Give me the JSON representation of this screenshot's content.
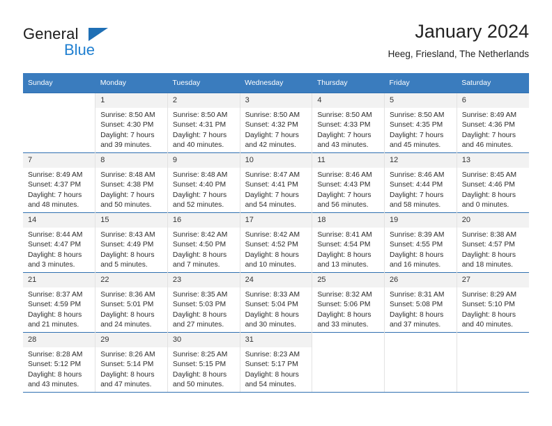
{
  "brand": {
    "name_top": "General",
    "name_bottom": "Blue",
    "accent_color": "#1f7fd0",
    "triangle_color": "#1f6fb5"
  },
  "header": {
    "title": "January 2024",
    "subtitle": "Heeg, Friesland, The Netherlands",
    "header_bg_color": "#3a7cbe",
    "row_divider_color": "#2f6fb0"
  },
  "weekday_headers": [
    "Sunday",
    "Monday",
    "Tuesday",
    "Wednesday",
    "Thursday",
    "Friday",
    "Saturday"
  ],
  "weeks": [
    [
      {
        "day": "",
        "sunrise": "",
        "sunset": "",
        "daylight_1": "",
        "daylight_2": ""
      },
      {
        "day": "1",
        "sunrise": "Sunrise: 8:50 AM",
        "sunset": "Sunset: 4:30 PM",
        "daylight_1": "Daylight: 7 hours",
        "daylight_2": "and 39 minutes."
      },
      {
        "day": "2",
        "sunrise": "Sunrise: 8:50 AM",
        "sunset": "Sunset: 4:31 PM",
        "daylight_1": "Daylight: 7 hours",
        "daylight_2": "and 40 minutes."
      },
      {
        "day": "3",
        "sunrise": "Sunrise: 8:50 AM",
        "sunset": "Sunset: 4:32 PM",
        "daylight_1": "Daylight: 7 hours",
        "daylight_2": "and 42 minutes."
      },
      {
        "day": "4",
        "sunrise": "Sunrise: 8:50 AM",
        "sunset": "Sunset: 4:33 PM",
        "daylight_1": "Daylight: 7 hours",
        "daylight_2": "and 43 minutes."
      },
      {
        "day": "5",
        "sunrise": "Sunrise: 8:50 AM",
        "sunset": "Sunset: 4:35 PM",
        "daylight_1": "Daylight: 7 hours",
        "daylight_2": "and 45 minutes."
      },
      {
        "day": "6",
        "sunrise": "Sunrise: 8:49 AM",
        "sunset": "Sunset: 4:36 PM",
        "daylight_1": "Daylight: 7 hours",
        "daylight_2": "and 46 minutes."
      }
    ],
    [
      {
        "day": "7",
        "sunrise": "Sunrise: 8:49 AM",
        "sunset": "Sunset: 4:37 PM",
        "daylight_1": "Daylight: 7 hours",
        "daylight_2": "and 48 minutes."
      },
      {
        "day": "8",
        "sunrise": "Sunrise: 8:48 AM",
        "sunset": "Sunset: 4:38 PM",
        "daylight_1": "Daylight: 7 hours",
        "daylight_2": "and 50 minutes."
      },
      {
        "day": "9",
        "sunrise": "Sunrise: 8:48 AM",
        "sunset": "Sunset: 4:40 PM",
        "daylight_1": "Daylight: 7 hours",
        "daylight_2": "and 52 minutes."
      },
      {
        "day": "10",
        "sunrise": "Sunrise: 8:47 AM",
        "sunset": "Sunset: 4:41 PM",
        "daylight_1": "Daylight: 7 hours",
        "daylight_2": "and 54 minutes."
      },
      {
        "day": "11",
        "sunrise": "Sunrise: 8:46 AM",
        "sunset": "Sunset: 4:43 PM",
        "daylight_1": "Daylight: 7 hours",
        "daylight_2": "and 56 minutes."
      },
      {
        "day": "12",
        "sunrise": "Sunrise: 8:46 AM",
        "sunset": "Sunset: 4:44 PM",
        "daylight_1": "Daylight: 7 hours",
        "daylight_2": "and 58 minutes."
      },
      {
        "day": "13",
        "sunrise": "Sunrise: 8:45 AM",
        "sunset": "Sunset: 4:46 PM",
        "daylight_1": "Daylight: 8 hours",
        "daylight_2": "and 0 minutes."
      }
    ],
    [
      {
        "day": "14",
        "sunrise": "Sunrise: 8:44 AM",
        "sunset": "Sunset: 4:47 PM",
        "daylight_1": "Daylight: 8 hours",
        "daylight_2": "and 3 minutes."
      },
      {
        "day": "15",
        "sunrise": "Sunrise: 8:43 AM",
        "sunset": "Sunset: 4:49 PM",
        "daylight_1": "Daylight: 8 hours",
        "daylight_2": "and 5 minutes."
      },
      {
        "day": "16",
        "sunrise": "Sunrise: 8:42 AM",
        "sunset": "Sunset: 4:50 PM",
        "daylight_1": "Daylight: 8 hours",
        "daylight_2": "and 7 minutes."
      },
      {
        "day": "17",
        "sunrise": "Sunrise: 8:42 AM",
        "sunset": "Sunset: 4:52 PM",
        "daylight_1": "Daylight: 8 hours",
        "daylight_2": "and 10 minutes."
      },
      {
        "day": "18",
        "sunrise": "Sunrise: 8:41 AM",
        "sunset": "Sunset: 4:54 PM",
        "daylight_1": "Daylight: 8 hours",
        "daylight_2": "and 13 minutes."
      },
      {
        "day": "19",
        "sunrise": "Sunrise: 8:39 AM",
        "sunset": "Sunset: 4:55 PM",
        "daylight_1": "Daylight: 8 hours",
        "daylight_2": "and 16 minutes."
      },
      {
        "day": "20",
        "sunrise": "Sunrise: 8:38 AM",
        "sunset": "Sunset: 4:57 PM",
        "daylight_1": "Daylight: 8 hours",
        "daylight_2": "and 18 minutes."
      }
    ],
    [
      {
        "day": "21",
        "sunrise": "Sunrise: 8:37 AM",
        "sunset": "Sunset: 4:59 PM",
        "daylight_1": "Daylight: 8 hours",
        "daylight_2": "and 21 minutes."
      },
      {
        "day": "22",
        "sunrise": "Sunrise: 8:36 AM",
        "sunset": "Sunset: 5:01 PM",
        "daylight_1": "Daylight: 8 hours",
        "daylight_2": "and 24 minutes."
      },
      {
        "day": "23",
        "sunrise": "Sunrise: 8:35 AM",
        "sunset": "Sunset: 5:03 PM",
        "daylight_1": "Daylight: 8 hours",
        "daylight_2": "and 27 minutes."
      },
      {
        "day": "24",
        "sunrise": "Sunrise: 8:33 AM",
        "sunset": "Sunset: 5:04 PM",
        "daylight_1": "Daylight: 8 hours",
        "daylight_2": "and 30 minutes."
      },
      {
        "day": "25",
        "sunrise": "Sunrise: 8:32 AM",
        "sunset": "Sunset: 5:06 PM",
        "daylight_1": "Daylight: 8 hours",
        "daylight_2": "and 33 minutes."
      },
      {
        "day": "26",
        "sunrise": "Sunrise: 8:31 AM",
        "sunset": "Sunset: 5:08 PM",
        "daylight_1": "Daylight: 8 hours",
        "daylight_2": "and 37 minutes."
      },
      {
        "day": "27",
        "sunrise": "Sunrise: 8:29 AM",
        "sunset": "Sunset: 5:10 PM",
        "daylight_1": "Daylight: 8 hours",
        "daylight_2": "and 40 minutes."
      }
    ],
    [
      {
        "day": "28",
        "sunrise": "Sunrise: 8:28 AM",
        "sunset": "Sunset: 5:12 PM",
        "daylight_1": "Daylight: 8 hours",
        "daylight_2": "and 43 minutes."
      },
      {
        "day": "29",
        "sunrise": "Sunrise: 8:26 AM",
        "sunset": "Sunset: 5:14 PM",
        "daylight_1": "Daylight: 8 hours",
        "daylight_2": "and 47 minutes."
      },
      {
        "day": "30",
        "sunrise": "Sunrise: 8:25 AM",
        "sunset": "Sunset: 5:15 PM",
        "daylight_1": "Daylight: 8 hours",
        "daylight_2": "and 50 minutes."
      },
      {
        "day": "31",
        "sunrise": "Sunrise: 8:23 AM",
        "sunset": "Sunset: 5:17 PM",
        "daylight_1": "Daylight: 8 hours",
        "daylight_2": "and 54 minutes."
      },
      {
        "day": "",
        "sunrise": "",
        "sunset": "",
        "daylight_1": "",
        "daylight_2": ""
      },
      {
        "day": "",
        "sunrise": "",
        "sunset": "",
        "daylight_1": "",
        "daylight_2": ""
      },
      {
        "day": "",
        "sunrise": "",
        "sunset": "",
        "daylight_1": "",
        "daylight_2": ""
      }
    ]
  ]
}
